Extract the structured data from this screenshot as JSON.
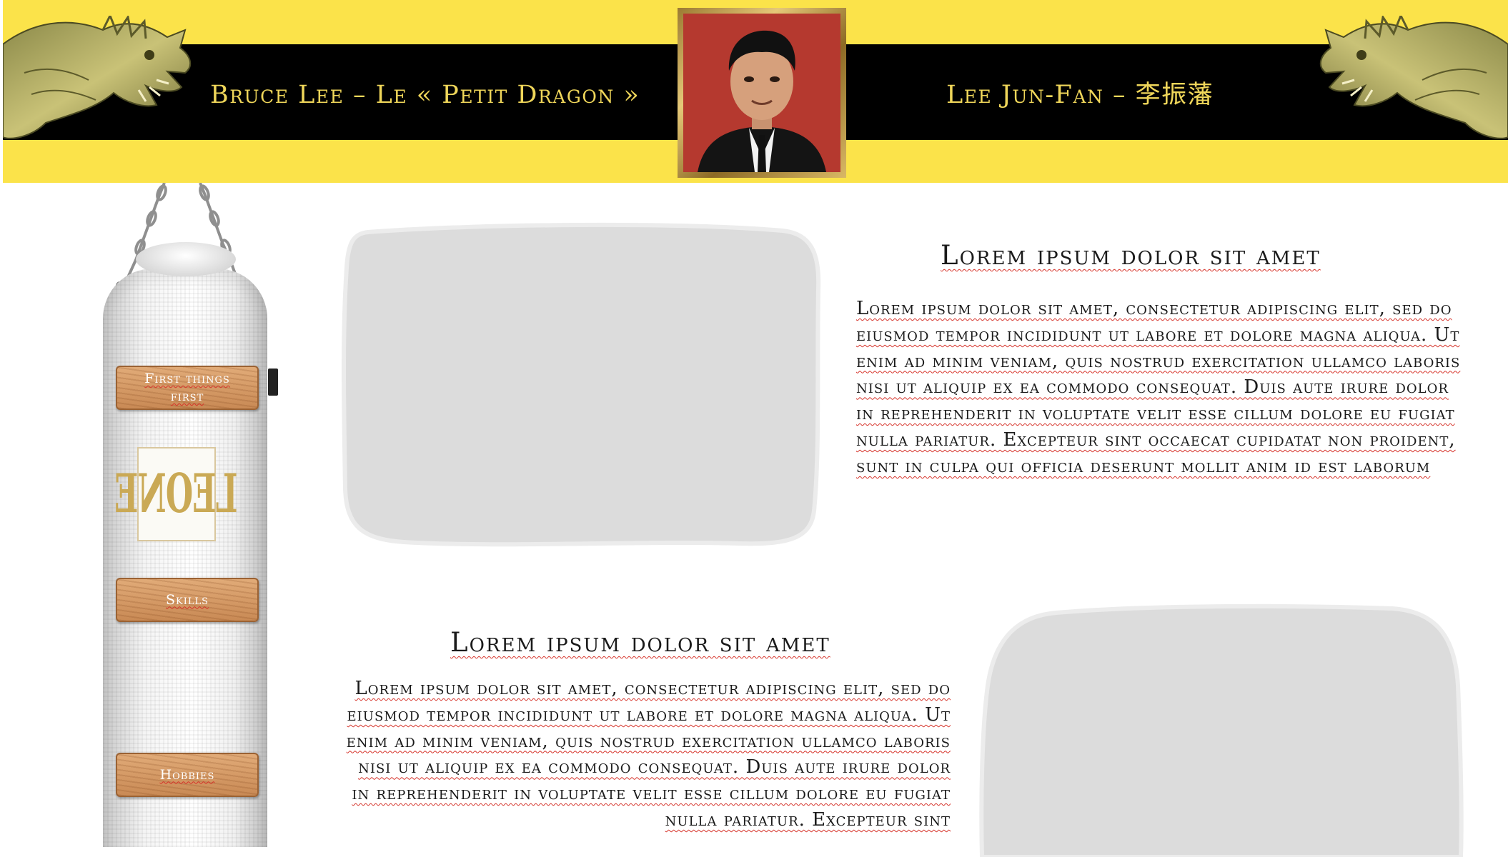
{
  "header": {
    "title_left": "Bruce Lee – Le « Petit Dragon »",
    "title_right": "Lee Jun-Fan – 李振藩",
    "portrait_icon": "portrait-photo",
    "dragon_icon": "golden-dragon-head"
  },
  "sidebar": {
    "bag_brand": "LEONE",
    "nav": [
      {
        "label": "First things first"
      },
      {
        "label": "Skills"
      },
      {
        "label": "Hobbies"
      }
    ]
  },
  "sections": [
    {
      "heading": "Lorem ipsum dolor sit amet",
      "body": "Lorem ipsum dolor sit amet, consectetur adipiscing elit, sed do eiusmod tempor incididunt ut labore et dolore magna aliqua. Ut enim ad minim veniam, quis nostrud exercitation ullamco laboris nisi ut aliquip ex ea commodo consequat. Duis aute irure dolor in reprehenderit in voluptate velit esse cillum dolore eu fugiat nulla pariatur. Excepteur sint occaecat cupidatat non proident, sunt in culpa qui officia deserunt mollit anim id est laborum"
    },
    {
      "heading": "Lorem ipsum dolor sit amet",
      "body": "Lorem ipsum dolor sit amet, consectetur adipiscing elit, sed do eiusmod tempor incididunt ut labore et dolore magna aliqua. Ut enim ad minim veniam, quis nostrud exercitation ullamco laboris nisi ut aliquip ex ea commodo consequat. Duis aute irure dolor in reprehenderit in voluptate velit esse cillum dolore eu fugiat nulla pariatur. Excepteur sint"
    }
  ],
  "colors": {
    "header_yellow": "#fbe34a",
    "header_black": "#000000",
    "title_gold": "#efd65a",
    "placeholder_gray": "#dcdcdc",
    "button_wood": "#d39a64",
    "spellcheck_red": "#d6332a"
  }
}
